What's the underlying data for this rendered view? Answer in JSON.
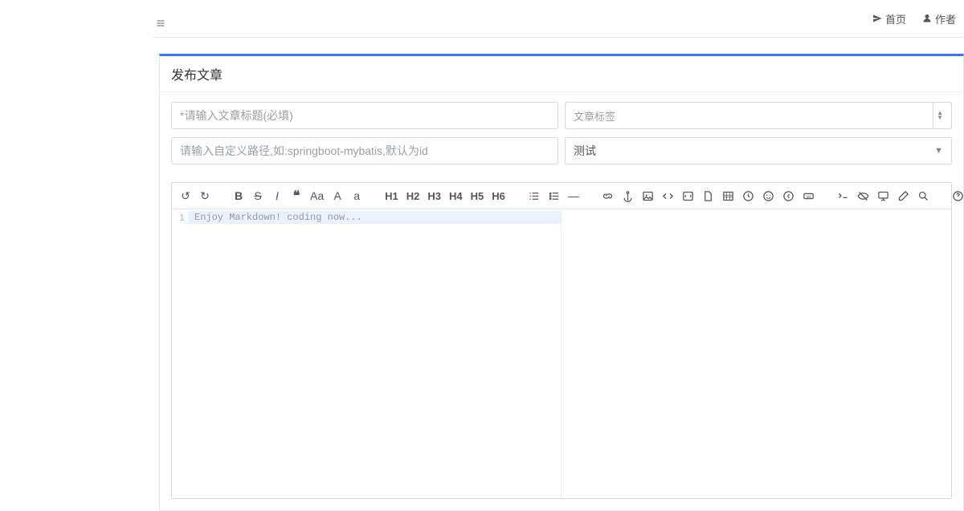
{
  "nav": {
    "home": "首页",
    "author": "作者"
  },
  "panel": {
    "title": "发布文章"
  },
  "form": {
    "title_placeholder": "*请输入文章标题(必填)",
    "tag_placeholder": "文章标签",
    "path_placeholder": "请输入自定义路径,如:springboot-mybatis,默认为id",
    "category_selected": "测试"
  },
  "toolbar": {
    "undo": "↺",
    "redo": "↻",
    "bold": "B",
    "strike": "S",
    "italic": "I",
    "quote": "❝",
    "font_aa": "Aa",
    "font_A": "A",
    "font_a": "a",
    "h1": "H1",
    "h2": "H2",
    "h3": "H3",
    "h4": "H4",
    "h5": "H5",
    "h6": "H6",
    "hr": "—"
  },
  "editor": {
    "line1_no": "1",
    "placeholder": "Enjoy Markdown!  coding now..."
  }
}
